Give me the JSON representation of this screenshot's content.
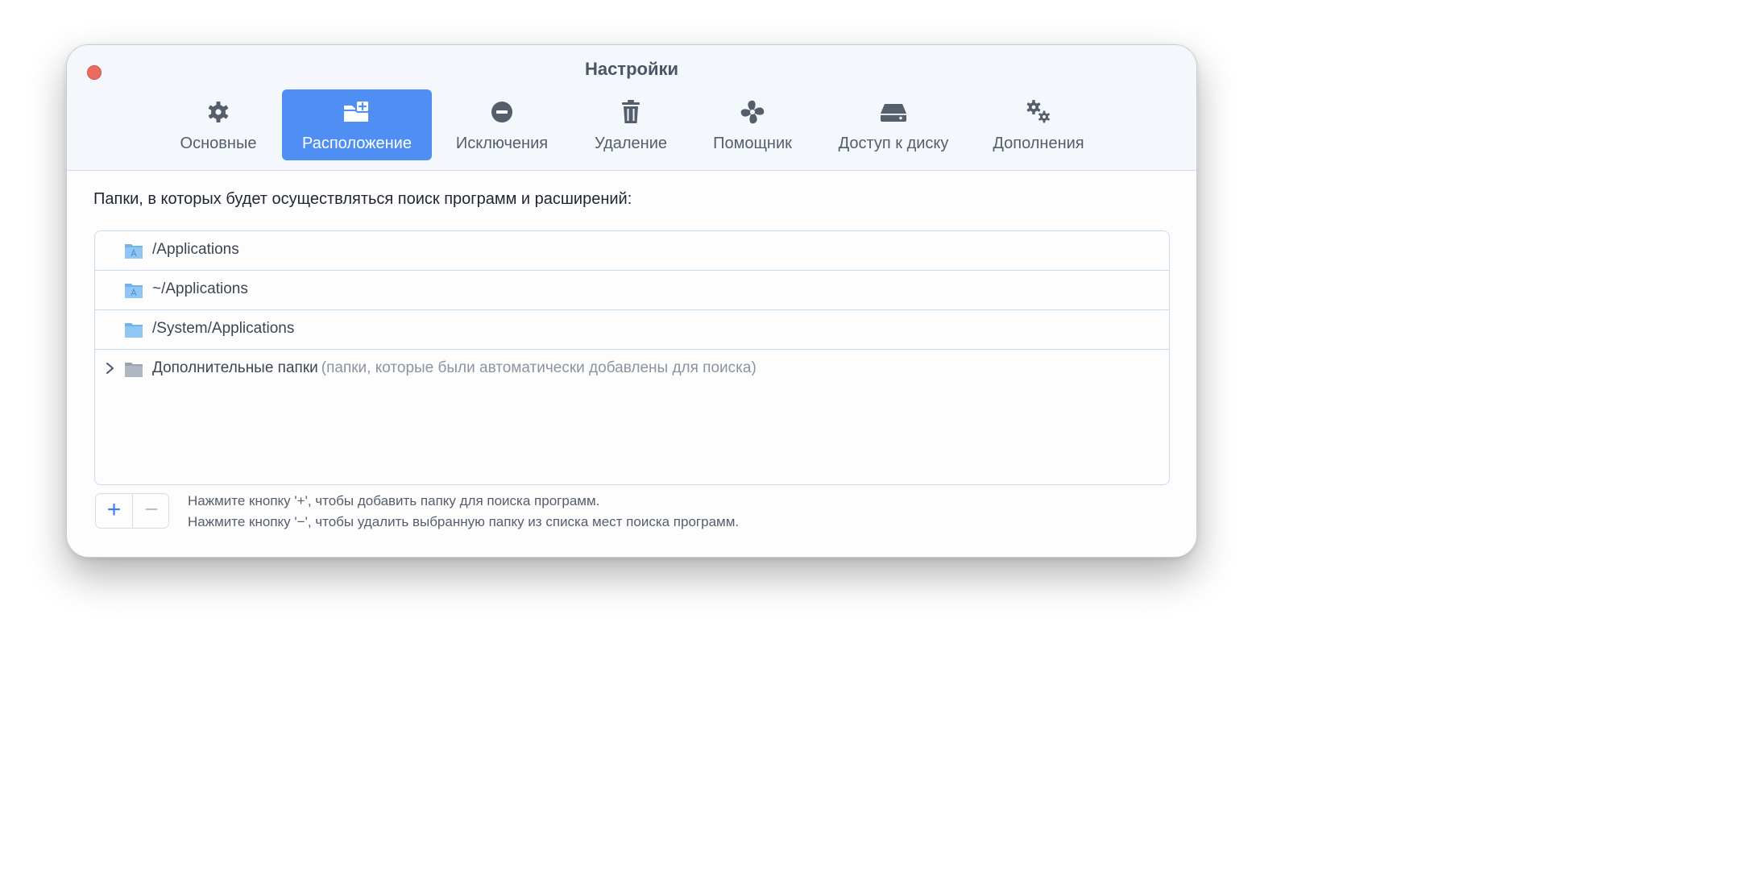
{
  "window": {
    "title": "Настройки"
  },
  "tabs": [
    {
      "label": "Основные",
      "icon": "gear-icon"
    },
    {
      "label": "Расположение",
      "icon": "folder-add-icon",
      "active": true
    },
    {
      "label": "Исключения",
      "icon": "minus-circle-icon"
    },
    {
      "label": "Удаление",
      "icon": "trash-icon"
    },
    {
      "label": "Помощник",
      "icon": "fan-icon"
    },
    {
      "label": "Доступ к диску",
      "icon": "disk-icon"
    },
    {
      "label": "Дополнения",
      "icon": "gears-icon"
    }
  ],
  "main": {
    "heading": "Папки, в которых будет осуществляться поиск программ и расширений:",
    "folders": [
      {
        "path": "/Applications",
        "icon": "applications-folder-icon"
      },
      {
        "path": "~/Applications",
        "icon": "applications-folder-icon"
      },
      {
        "path": "/System/Applications",
        "icon": "folder-icon"
      }
    ],
    "extra": {
      "label": "Дополнительные папки",
      "note": "(папки, которые были автоматически добавлены для поиска)",
      "icon": "gray-folder-icon"
    }
  },
  "controls": {
    "add_label": "+",
    "remove_label": "−",
    "hint_add": "Нажмите кнопку '+', чтобы добавить папку для поиска программ.",
    "hint_remove": "Нажмите кнопку '−', чтобы удалить выбранную папку из списка мест поиска программ."
  },
  "colors": {
    "accent": "#4f8ff3",
    "close": "#ed6a5e"
  }
}
